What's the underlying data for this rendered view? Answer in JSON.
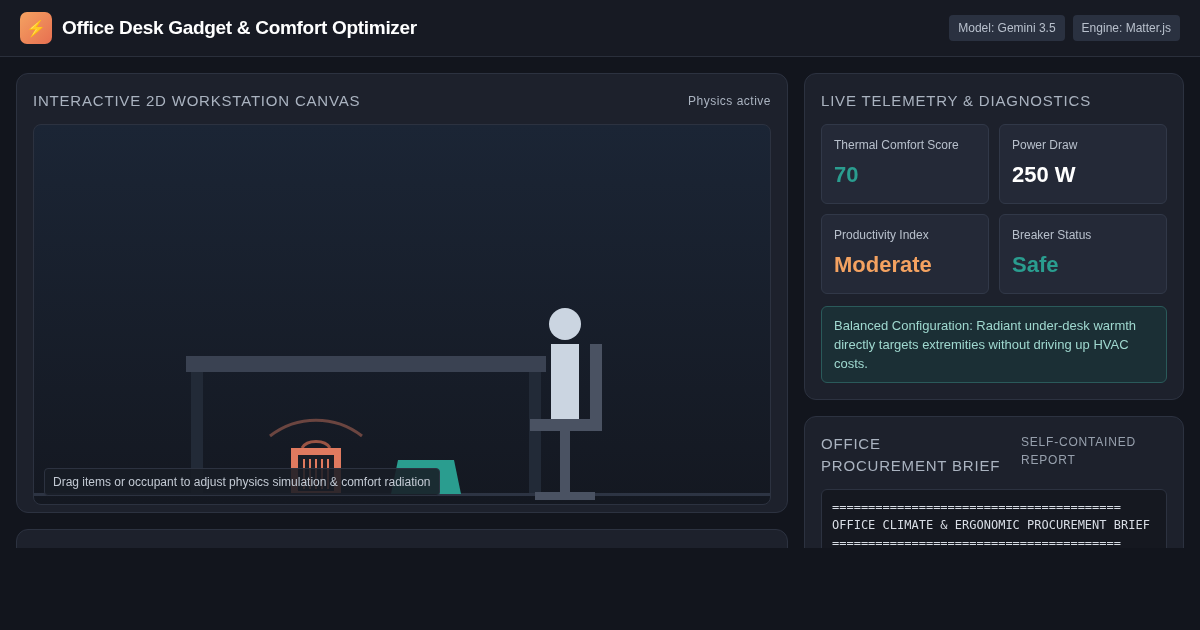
{
  "header": {
    "logo_glyph": "⚡",
    "title": "Office Desk Gadget & Comfort Optimizer",
    "badges": [
      "Model: Gemini 3.5",
      "Engine: Matter.js"
    ]
  },
  "canvas_panel": {
    "title": "INTERACTIVE 2D WORKSTATION CANVAS",
    "status": "Physics active",
    "hint": "Drag items or occupant to adjust physics simulation & comfort radiation"
  },
  "telemetry": {
    "title": "LIVE TELEMETRY & DIAGNOSTICS",
    "metrics": [
      {
        "label": "Thermal Comfort Score",
        "value": "70",
        "color": "#2a9d8f"
      },
      {
        "label": "Power Draw",
        "value": "250 W",
        "color": "#ffffff"
      },
      {
        "label": "Productivity Index",
        "value": "Moderate",
        "color": "#f4a261"
      },
      {
        "label": "Breaker Status",
        "value": "Safe",
        "color": "#2a9d8f"
      }
    ],
    "note": "Balanced Configuration: Radiant under-desk warmth directly targets extremities without driving up HVAC costs."
  },
  "procurement": {
    "title": "OFFICE PROCUREMENT BRIEF",
    "tag": "SELF-CONTAINED REPORT",
    "report_lines": [
      "========================================",
      "OFFICE CLIMATE & ERGONOMIC PROCUREMENT BRIEF",
      "========================================"
    ]
  }
}
